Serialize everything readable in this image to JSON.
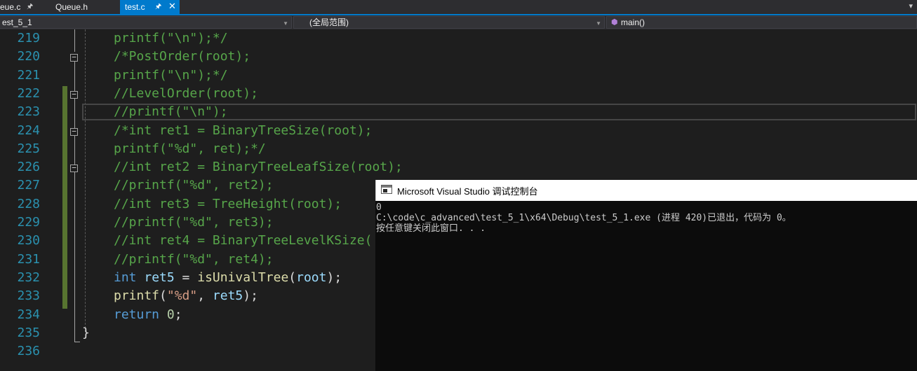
{
  "tabs": [
    {
      "label": "eue.c",
      "pin": "⌂"
    },
    {
      "label": "Queue.h"
    },
    {
      "label": "test.c",
      "pin": "⌂",
      "close": "✕",
      "active": true
    }
  ],
  "tab_overflow_icon": "chevron-down",
  "nav": {
    "project": "est_5_1",
    "scope": "(全局范围)",
    "function": "main()"
  },
  "editor": {
    "line_numbers": [
      "219",
      "220",
      "221",
      "222",
      "223",
      "224",
      "225",
      "226",
      "227",
      "228",
      "229",
      "230",
      "231",
      "232",
      "233",
      "234",
      "235",
      "236"
    ],
    "lines": [
      "printf(\"\\n\");*/",
      "/*PostOrder(root);",
      "printf(\"\\n\");*/",
      "//LevelOrder(root);",
      "//printf(\"\\n\");",
      "/*int ret1 = BinaryTreeSize(root);",
      "printf(\"%d\", ret);*/",
      "//int ret2 = BinaryTreeLeafSize(root);",
      "//printf(\"%d\", ret2);",
      "//int ret3 = TreeHeight(root);",
      "//printf(\"%d\", ret3);",
      "//int ret4 = BinaryTreeLevelKSize(",
      "//printf(\"%d\", ret4);"
    ],
    "line_232": {
      "kw": "int",
      "var": "ret5",
      "eq": " = ",
      "fn": "isUnivalTree",
      "open": "(",
      "arg": "root",
      "close": ");"
    },
    "line_233": {
      "fn": "printf",
      "open": "(",
      "str": "\"%d\"",
      "sep": ", ",
      "arg": "ret5",
      "close": ");"
    },
    "line_234": {
      "kw": "return",
      "num": "0",
      "semi": ";"
    },
    "line_235": "}",
    "colors": {
      "line_number": "#2b91af",
      "comment": "#57a64a",
      "keyword": "#569cd6",
      "string": "#d69d85",
      "change_bar": "#577430"
    }
  },
  "console": {
    "title": "Microsoft Visual Studio 调试控制台",
    "lines": [
      "0",
      "C:\\code\\c_advanced\\test_5_1\\x64\\Debug\\test_5_1.exe (进程 420)已退出，代码为 0。",
      "按任意键关闭此窗口. . ."
    ]
  }
}
